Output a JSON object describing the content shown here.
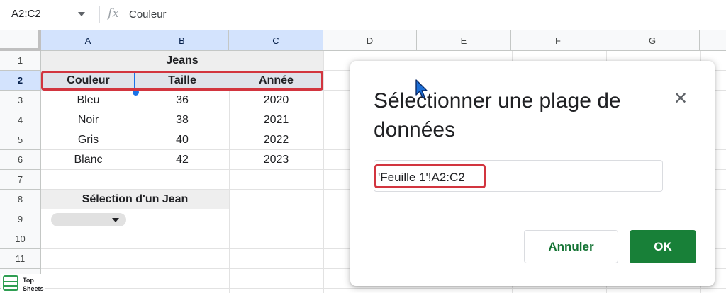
{
  "formula_bar": {
    "name_box": "A2:C2",
    "fx_symbol": "fx",
    "value": "Couleur"
  },
  "columns": [
    "A",
    "B",
    "C",
    "D",
    "E",
    "F",
    "G"
  ],
  "rows": [
    "1",
    "2",
    "3",
    "4",
    "5",
    "6",
    "7",
    "8",
    "9",
    "10",
    "11"
  ],
  "sheet": {
    "title": "Jeans",
    "headers": [
      "Couleur",
      "Taille",
      "Année"
    ],
    "data": [
      [
        "Bleu",
        "36",
        "2020"
      ],
      [
        "Noir",
        "38",
        "2021"
      ],
      [
        "Gris",
        "40",
        "2022"
      ],
      [
        "Blanc",
        "42",
        "2023"
      ]
    ],
    "selection_label": "Sélection d'un Jean"
  },
  "dialog": {
    "title": "Sélectionner une plage de données",
    "range_value": "'Feuille 1'!A2:C2",
    "cancel_label": "Annuler",
    "ok_label": "OK"
  },
  "watermark": {
    "line1": "Top",
    "line2": "Sheets"
  },
  "colors": {
    "accent_green": "#188038",
    "highlight_red": "#d2353f",
    "selection_blue": "#1a73e8"
  }
}
